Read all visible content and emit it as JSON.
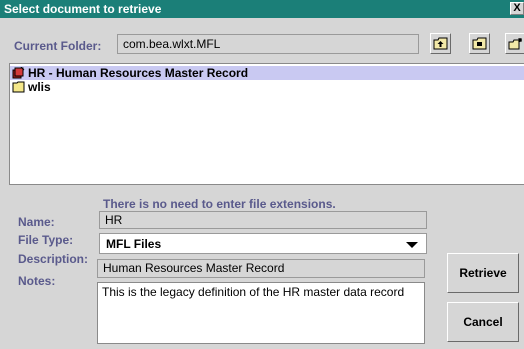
{
  "window": {
    "title": "Select document to retrieve",
    "close_label": "X"
  },
  "folder": {
    "label": "Current Folder:",
    "value": "com.bea.wlxt.MFL"
  },
  "toolbar": {
    "icons": [
      "folder-up-icon",
      "folder-home-icon",
      "new-folder-icon"
    ]
  },
  "files": [
    {
      "label": "HR - Human Resources Master Record",
      "icon": "document-icon",
      "selected": true
    },
    {
      "label": "wlis",
      "icon": "folder-icon",
      "selected": false
    }
  ],
  "form": {
    "hint": "There is no need to enter file extensions.",
    "name_label": "Name:",
    "name_value": "HR",
    "filetype_label": "File Type:",
    "filetype_value": "MFL Files",
    "description_label": "Description:",
    "description_value": "Human Resources Master Record",
    "notes_label": "Notes:",
    "notes_value": "This is the legacy definition of the HR master data record"
  },
  "buttons": {
    "retrieve": "Retrieve",
    "cancel": "Cancel"
  },
  "colors": {
    "title_bar": "#1b7f78",
    "label": "#5a5a8c",
    "selection": "#c9c9f2",
    "panel": "#d6d6d6"
  }
}
